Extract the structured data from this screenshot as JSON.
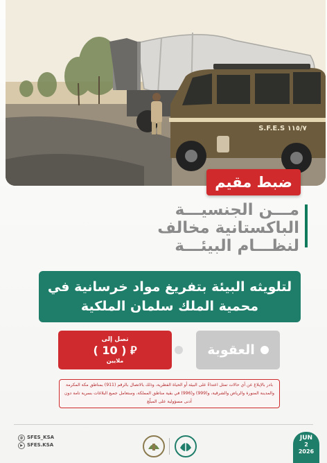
{
  "tag": {
    "label": "ضبط مقيم"
  },
  "headline": {
    "lines": [
      "مـــن الجنسيـــة",
      "الباكستانية مخالف",
      "لنظـــام البيئـــة"
    ]
  },
  "violation": {
    "line1": "لتلويثه البيئة بتفريغ مواد خرسانية في",
    "line2": "محمية الملك سلمان الملكية"
  },
  "penalty": {
    "label": "العقوبة",
    "up_to": "تصل إلى",
    "amount": "( 10 ) ⃁",
    "unit": "ملايين"
  },
  "notice": {
    "text": "بادر بالإبلاغ عن أي حالات تمثل اعتداءً على البيئة أو الحياة الفطرية، وذلك بالاتصال بالرقم (911) بمناطق مكة المكرمة والمدينة المنورة والرياض والشرقية، و(999) و(996) في بقية مناطق المملكة، وستعامل جميع البلاغات بسرية تامة دون أدنى مسؤولية على المبلّغ"
  },
  "footer": {
    "social_1": "SFES_KSA",
    "social_2": "SFES.KSA",
    "date_month": "JUN",
    "date_day": "2",
    "date_year": "2026"
  },
  "photo": {
    "vehicle_plate": "S.F.E.S ١١٥/٧"
  },
  "colors": {
    "red": "#cf2b2f",
    "green": "#1f7e6a",
    "gray": "#c9c9c9"
  }
}
